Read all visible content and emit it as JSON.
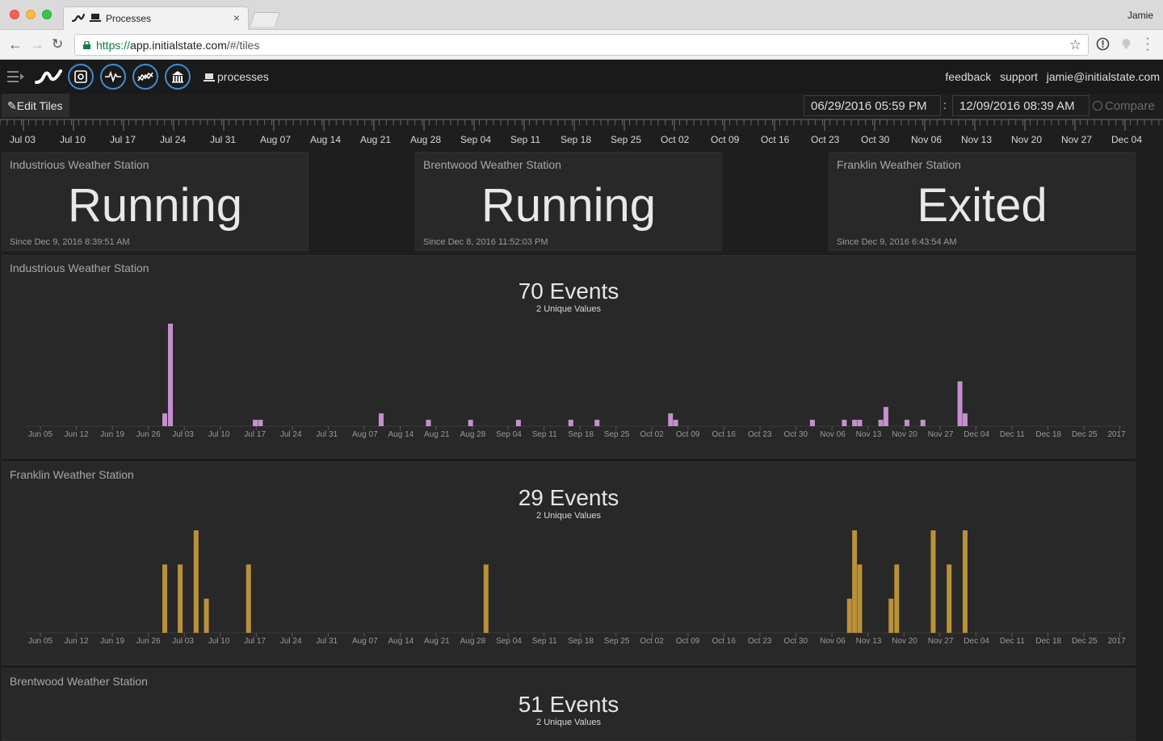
{
  "browser": {
    "tab_title": "Processes",
    "tab_close": "×",
    "profile": "Jamie",
    "url_scheme": "https://",
    "url_host": "app.initialstate.com",
    "url_path": "/#/tiles",
    "star": "☆",
    "back": "←",
    "forward": "→",
    "reload": "↻"
  },
  "header": {
    "bucket": "processes",
    "links": [
      "feedback",
      "support",
      "jamie@initialstate.com"
    ],
    "accent": "#3b8fd6"
  },
  "toolbar": {
    "edit_label": "Edit Tiles",
    "date_start": "06/29/2016 05:59 PM",
    "date_sep": ":",
    "date_end": "12/09/2016 08:39 AM",
    "compare_label": "Compare"
  },
  "timeline": {
    "labels": [
      "Jul 03",
      "Jul 10",
      "Jul 17",
      "Jul 24",
      "Jul 31",
      "Aug 07",
      "Aug 14",
      "Aug 21",
      "Aug 28",
      "Sep 04",
      "Sep 11",
      "Sep 18",
      "Sep 25",
      "Oct 02",
      "Oct 09",
      "Oct 16",
      "Oct 23",
      "Oct 30",
      "Nov 06",
      "Nov 13",
      "Nov 20",
      "Nov 27",
      "Dec 04"
    ]
  },
  "status_tiles": [
    {
      "title": "Industrious Weather Station",
      "value": "Running",
      "since": "Since Dec 9, 2016 8:39:51 AM"
    },
    {
      "title": "Brentwood Weather Station",
      "value": "Running",
      "since": "Since Dec 8, 2016 11:52:03 PM"
    },
    {
      "title": "Franklin Weather Station",
      "value": "Exited",
      "since": "Since Dec 9, 2016 6:43:54 AM"
    }
  ],
  "event_tiles": [
    {
      "title": "Industrious Weather Station",
      "count": "70 Events",
      "unique": "2 Unique Values"
    },
    {
      "title": "Franklin Weather Station",
      "count": "29 Events",
      "unique": "2 Unique Values"
    },
    {
      "title": "Brentwood Weather Station",
      "count": "51 Events",
      "unique": "2 Unique Values"
    }
  ],
  "chart_data": [
    {
      "type": "bar",
      "title": "Industrious Weather Station",
      "color": "#c58fce",
      "x_ticks": [
        "Jun 05",
        "Jun 12",
        "Jun 19",
        "Jun 26",
        "Jul 03",
        "Jul 10",
        "Jul 17",
        "Jul 24",
        "Jul 31",
        "Aug 07",
        "Aug 14",
        "Aug 21",
        "Aug 28",
        "Sep 04",
        "Sep 11",
        "Sep 18",
        "Sep 25",
        "Oct 02",
        "Oct 09",
        "Oct 16",
        "Oct 23",
        "Oct 30",
        "Nov 06",
        "Nov 13",
        "Nov 20",
        "Nov 27",
        "Dec 04",
        "Dec 11",
        "Dec 18",
        "Dec 25",
        "2017"
      ],
      "ylim": [
        0,
        16
      ],
      "bars": [
        {
          "x": 24.2,
          "v": 2
        },
        {
          "x": 25.3,
          "v": 16
        },
        {
          "x": 41.8,
          "v": 1
        },
        {
          "x": 42.8,
          "v": 1
        },
        {
          "x": 66.3,
          "v": 2
        },
        {
          "x": 75.5,
          "v": 1
        },
        {
          "x": 83.7,
          "v": 1
        },
        {
          "x": 93.0,
          "v": 1
        },
        {
          "x": 103.2,
          "v": 1
        },
        {
          "x": 108.3,
          "v": 1
        },
        {
          "x": 122.6,
          "v": 2
        },
        {
          "x": 123.6,
          "v": 1
        },
        {
          "x": 150.2,
          "v": 1
        },
        {
          "x": 156.4,
          "v": 1
        },
        {
          "x": 158.4,
          "v": 1
        },
        {
          "x": 159.4,
          "v": 1
        },
        {
          "x": 163.5,
          "v": 1
        },
        {
          "x": 164.5,
          "v": 3
        },
        {
          "x": 168.6,
          "v": 1
        },
        {
          "x": 171.7,
          "v": 1
        },
        {
          "x": 178.9,
          "v": 7
        },
        {
          "x": 179.9,
          "v": 2
        }
      ]
    },
    {
      "type": "bar",
      "title": "Franklin Weather Station",
      "color": "#b8913a",
      "x_ticks": [
        "Jun 05",
        "Jun 12",
        "Jun 19",
        "Jun 26",
        "Jul 03",
        "Jul 10",
        "Jul 17",
        "Jul 24",
        "Jul 31",
        "Aug 07",
        "Aug 14",
        "Aug 21",
        "Aug 28",
        "Sep 04",
        "Sep 11",
        "Sep 18",
        "Sep 25",
        "Oct 02",
        "Oct 09",
        "Oct 16",
        "Oct 23",
        "Oct 30",
        "Nov 06",
        "Nov 13",
        "Nov 20",
        "Nov 27",
        "Dec 04",
        "Dec 11",
        "Dec 18",
        "Dec 25",
        "2017"
      ],
      "ylim": [
        0,
        3
      ],
      "bars": [
        {
          "x": 24.2,
          "v": 2
        },
        {
          "x": 27.2,
          "v": 2
        },
        {
          "x": 30.3,
          "v": 3
        },
        {
          "x": 32.3,
          "v": 1
        },
        {
          "x": 40.5,
          "v": 2
        },
        {
          "x": 86.7,
          "v": 2
        },
        {
          "x": 157.4,
          "v": 1
        },
        {
          "x": 158.4,
          "v": 3
        },
        {
          "x": 159.4,
          "v": 2
        },
        {
          "x": 165.5,
          "v": 1
        },
        {
          "x": 166.6,
          "v": 2
        },
        {
          "x": 173.7,
          "v": 3
        },
        {
          "x": 176.8,
          "v": 2
        },
        {
          "x": 179.9,
          "v": 3
        }
      ]
    }
  ]
}
